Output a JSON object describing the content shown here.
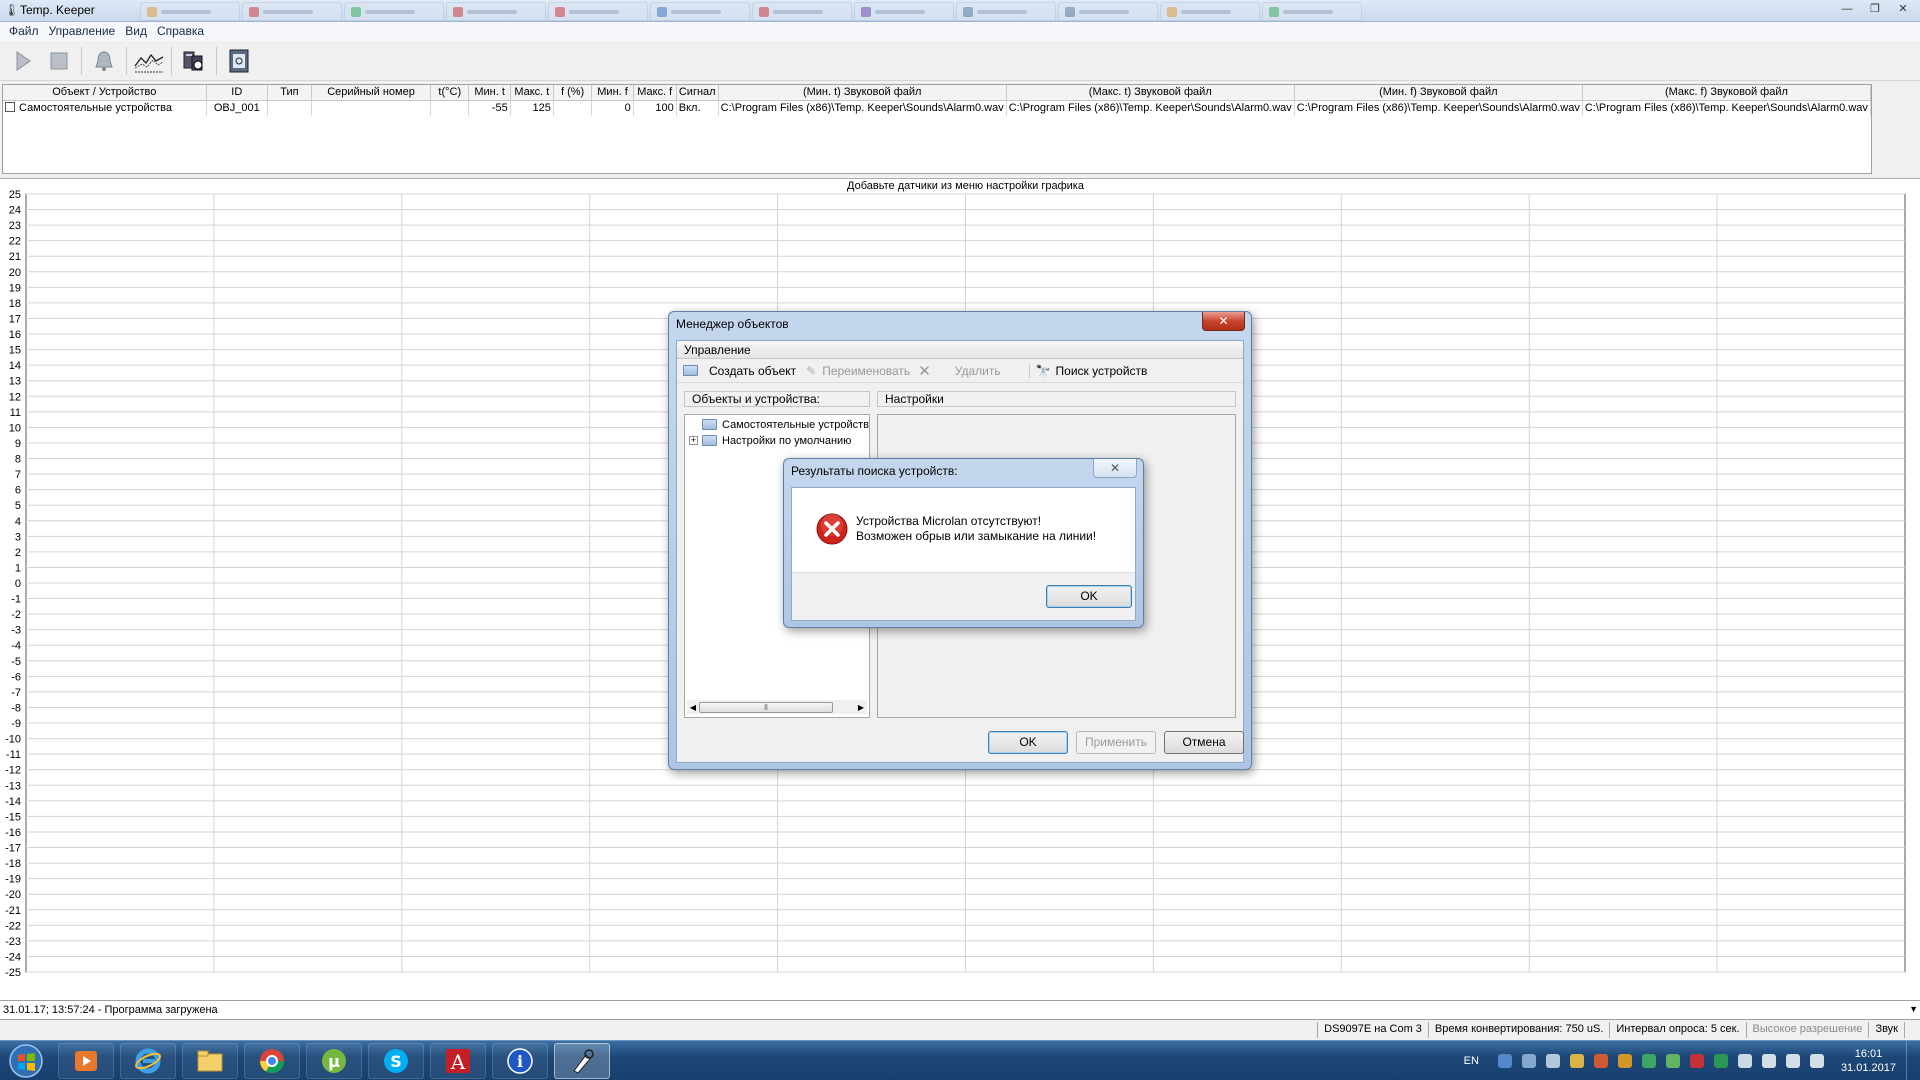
{
  "window": {
    "title": "Temp. Keeper",
    "controls": [
      "—",
      "❐",
      "✕"
    ]
  },
  "menu": [
    "Файл",
    "Управление",
    "Вид",
    "Справка"
  ],
  "toolbar": [
    "play-icon",
    "stop-icon",
    "bell-icon",
    "chart-settings-icon",
    "device-search-icon",
    "report-icon"
  ],
  "grid": {
    "columns": [
      "Объект / Устройство",
      "ID",
      "Тип",
      "Серийный номер",
      "t(°C)",
      "Мин. t",
      "Макс. t",
      "f (%)",
      "Мин. f",
      "Макс. f",
      "Сигнал",
      "(Мин. t) Звуковой файл",
      "(Макс. t) Звуковой файл",
      "(Мин. f) Звуковой файл",
      "(Макс. f) Звуковой файл"
    ],
    "rows": [
      [
        "Самостоятельные устройства",
        "OBJ_001",
        "",
        "",
        "",
        "-55",
        "125",
        "",
        "0",
        "100",
        "Вкл.",
        "C:\\Program Files (x86)\\Temp. Keeper\\Sounds\\Alarm0.wav",
        "C:\\Program Files (x86)\\Temp. Keeper\\Sounds\\Alarm0.wav",
        "C:\\Program Files (x86)\\Temp. Keeper\\Sounds\\Alarm0.wav",
        "C:\\Program Files (x86)\\Temp. Keeper\\Sounds\\Alarm0.wav"
      ]
    ]
  },
  "chart": {
    "message": "Добавьте датчики из меню настройки графика",
    "y_ticks": [
      "25",
      "24",
      "23",
      "22",
      "21",
      "20",
      "19",
      "18",
      "17",
      "16",
      "15",
      "14",
      "13",
      "12",
      "11",
      "10",
      "9",
      "8",
      "7",
      "6",
      "5",
      "4",
      "3",
      "2",
      "1",
      "0",
      "-1",
      "-2",
      "-3",
      "-4",
      "-5",
      "-6",
      "-7",
      "-8",
      "-9",
      "-10",
      "-11",
      "-12",
      "-13",
      "-14",
      "-15",
      "-16",
      "-17",
      "-18",
      "-19",
      "-20",
      "-21",
      "-22",
      "-23",
      "-24",
      "-25"
    ],
    "vertical_gridlines": 10
  },
  "log": "31.01.17; 13:57:24 - Программа загружена",
  "status": [
    "DS9097E на Com 3",
    "Время конвертирования: 750 uS.",
    "Интервал опроса: 5 сек.",
    "Высокое разрешение",
    "Звук"
  ],
  "object_manager": {
    "title": "Менеджер объектов",
    "section": "Управление",
    "actions": {
      "create": "Создать объект",
      "rename": "Переименовать",
      "delete": "Удалить",
      "search": "Поиск устройств"
    },
    "objects_header": "Объекты и устройства:",
    "settings_header": "Настройки",
    "tree": [
      "Самостоятельные устройства",
      "Настройки по умолчанию"
    ],
    "buttons": {
      "ok": "OK",
      "apply": "Применить",
      "cancel": "Отмена"
    }
  },
  "search_results": {
    "title": "Результаты поиска устройств:",
    "line1": "Устройства Microlan отсутствуют!",
    "line2": "Возможен обрыв или замыкание на линии!",
    "ok": "OK"
  },
  "taskbar": {
    "apps": [
      "media-player",
      "internet-explorer",
      "file-explorer",
      "chrome",
      "utorrent",
      "skype",
      "autocad",
      "info",
      "temp-keeper"
    ],
    "lang": "EN",
    "time": "16:01",
    "date": "31.01.2017"
  },
  "colors": {
    "taskbar": "#1d4777",
    "dialog_frame": "#aec6e4",
    "close_red": "#c8462f",
    "error_red": "#d0231c"
  }
}
